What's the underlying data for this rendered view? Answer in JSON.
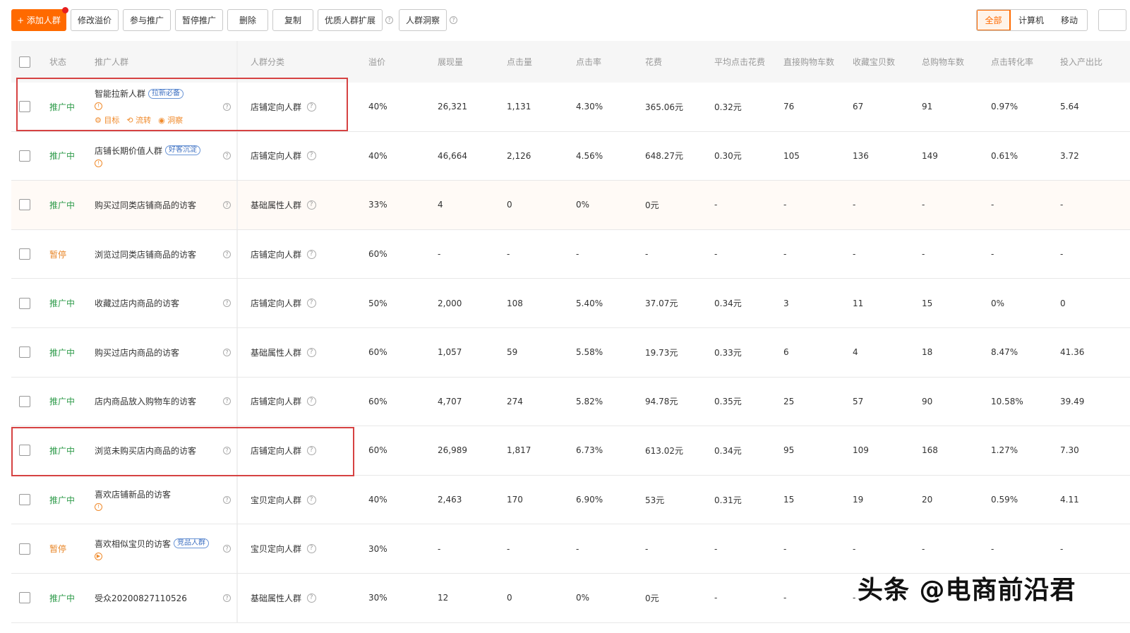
{
  "toolbar": {
    "add_label": "+ 添加人群",
    "buttons": [
      "修改溢价",
      "参与推广",
      "暂停推广",
      "删除",
      "复制",
      "优质人群扩展",
      "人群洞察"
    ]
  },
  "device_filter": {
    "all": "全部",
    "computer": "计算机",
    "mobile": "移动"
  },
  "columns": [
    "状态",
    "推广人群",
    "人群分类",
    "溢价",
    "展现量",
    "点击量",
    "点击率",
    "花费",
    "平均点击花费",
    "直接购物车数",
    "收藏宝贝数",
    "总购物车数",
    "点击转化率",
    "投入产出比"
  ],
  "rows": [
    {
      "status": "推广中",
      "name": "智能拉新人群",
      "tag": "拉新必备",
      "has_sub_icon": true,
      "actions": [
        "目标",
        "流转",
        "洞察"
      ],
      "category": "店铺定向人群",
      "premium": "40%",
      "impressions": "26,321",
      "clicks": "1,131",
      "ctr": "4.30%",
      "cost": "365.06元",
      "cpc": "0.32元",
      "direct_cart": "76",
      "fav": "67",
      "total_cart": "91",
      "cvr": "0.97%",
      "roi": "5.64"
    },
    {
      "status": "推广中",
      "name": "店铺长期价值人群",
      "tag": "好客沉淀",
      "has_sub_icon": true,
      "category": "店铺定向人群",
      "premium": "40%",
      "impressions": "46,664",
      "clicks": "2,126",
      "ctr": "4.56%",
      "cost": "648.27元",
      "cpc": "0.30元",
      "direct_cart": "105",
      "fav": "136",
      "total_cart": "149",
      "cvr": "0.61%",
      "roi": "3.72"
    },
    {
      "status": "推广中",
      "name": "购买过同类店铺商品的访客",
      "category": "基础属性人群",
      "premium": "33%",
      "impressions": "4",
      "clicks": "0",
      "ctr": "0%",
      "cost": "0元",
      "cpc": "-",
      "direct_cart": "-",
      "fav": "-",
      "total_cart": "-",
      "cvr": "-",
      "roi": "-"
    },
    {
      "status": "暂停",
      "name": "浏览过同类店铺商品的访客",
      "category": "店铺定向人群",
      "premium": "60%",
      "impressions": "-",
      "clicks": "-",
      "ctr": "-",
      "cost": "-",
      "cpc": "-",
      "direct_cart": "-",
      "fav": "-",
      "total_cart": "-",
      "cvr": "-",
      "roi": "-"
    },
    {
      "status": "推广中",
      "name": "收藏过店内商品的访客",
      "category": "店铺定向人群",
      "premium": "50%",
      "impressions": "2,000",
      "clicks": "108",
      "ctr": "5.40%",
      "cost": "37.07元",
      "cpc": "0.34元",
      "direct_cart": "3",
      "fav": "11",
      "total_cart": "15",
      "cvr": "0%",
      "roi": "0"
    },
    {
      "status": "推广中",
      "name": "购买过店内商品的访客",
      "category": "基础属性人群",
      "premium": "60%",
      "impressions": "1,057",
      "clicks": "59",
      "ctr": "5.58%",
      "cost": "19.73元",
      "cpc": "0.33元",
      "direct_cart": "6",
      "fav": "4",
      "total_cart": "18",
      "cvr": "8.47%",
      "roi": "41.36"
    },
    {
      "status": "推广中",
      "name": "店内商品放入购物车的访客",
      "category": "店铺定向人群",
      "premium": "60%",
      "impressions": "4,707",
      "clicks": "274",
      "ctr": "5.82%",
      "cost": "94.78元",
      "cpc": "0.35元",
      "direct_cart": "25",
      "fav": "57",
      "total_cart": "90",
      "cvr": "10.58%",
      "roi": "39.49"
    },
    {
      "status": "推广中",
      "name": "浏览未购买店内商品的访客",
      "category": "店铺定向人群",
      "premium": "60%",
      "impressions": "26,989",
      "clicks": "1,817",
      "ctr": "6.73%",
      "cost": "613.02元",
      "cpc": "0.34元",
      "direct_cart": "95",
      "fav": "109",
      "total_cart": "168",
      "cvr": "1.27%",
      "roi": "7.30"
    },
    {
      "status": "推广中",
      "name": "喜欢店铺新品的访客",
      "has_sub_icon": true,
      "category": "宝贝定向人群",
      "premium": "40%",
      "impressions": "2,463",
      "clicks": "170",
      "ctr": "6.90%",
      "cost": "53元",
      "cpc": "0.31元",
      "direct_cart": "15",
      "fav": "19",
      "total_cart": "20",
      "cvr": "0.59%",
      "roi": "4.11"
    },
    {
      "status": "暂停",
      "name": "喜欢相似宝贝的访客",
      "tag": "竞品人群",
      "has_play_icon": true,
      "category": "宝贝定向人群",
      "premium": "30%",
      "impressions": "-",
      "clicks": "-",
      "ctr": "-",
      "cost": "-",
      "cpc": "-",
      "direct_cart": "-",
      "fav": "-",
      "total_cart": "-",
      "cvr": "-",
      "roi": "-"
    },
    {
      "status": "推广中",
      "name": "受众20200827110526",
      "category": "基础属性人群",
      "premium": "30%",
      "impressions": "12",
      "clicks": "0",
      "ctr": "0%",
      "cost": "0元",
      "cpc": "-",
      "direct_cart": "-",
      "fav": "-",
      "total_cart": "",
      "cvr": "",
      "roi": ""
    }
  ],
  "watermark": "头条 @电商前沿君",
  "colors": {
    "accent": "#ff6a00",
    "active": "#2e9b4a",
    "paused": "#e8872a",
    "highlight": "#d64242",
    "tag": "#3f71c2"
  }
}
